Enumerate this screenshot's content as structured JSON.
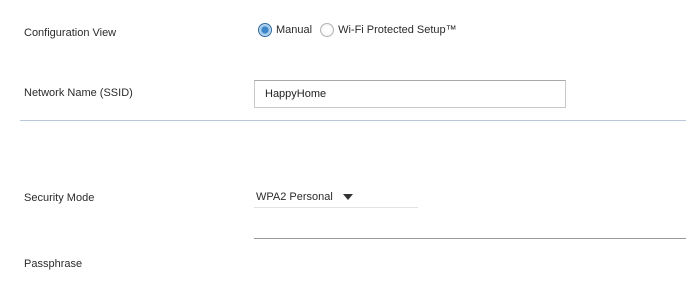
{
  "form": {
    "config_view": {
      "label": "Configuration View",
      "options": [
        {
          "label": "Manual",
          "checked": true
        },
        {
          "label": "Wi-Fi Protected Setup™",
          "checked": false
        }
      ]
    },
    "network_name": {
      "label": "Network Name (SSID)",
      "value": "HappyHome"
    },
    "security_mode": {
      "label": "Security Mode",
      "value": "WPA2 Personal"
    },
    "passphrase": {
      "label": "Passphrase",
      "value": ""
    }
  },
  "colors": {
    "divider": "#b9c7d8",
    "radio_checked": "#3a86c8",
    "text": "#2b2b2b"
  },
  "icons": {
    "caret": "chevron-down-icon"
  }
}
